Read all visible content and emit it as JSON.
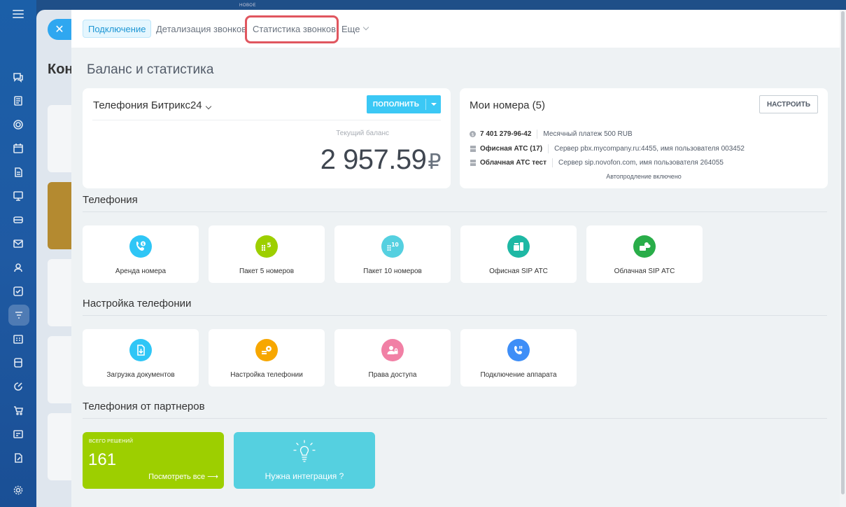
{
  "tabs": {
    "items": [
      {
        "label": "Подключение"
      },
      {
        "label": "Детализация звонков"
      },
      {
        "label": "Статистика звонков"
      },
      {
        "label": "Еще"
      }
    ]
  },
  "background": {
    "title": "Кон",
    "badge": "НОВОЕ"
  },
  "page_title": "Баланс и статистика",
  "telephony_card": {
    "title": "Телефония Битрикс24",
    "topup_label": "ПОПОЛНИТЬ",
    "balance_label": "Текущий баланс",
    "balance_value": "2 957.59",
    "currency": "₽"
  },
  "numbers_card": {
    "title": "Мои номера (5)",
    "setup_label": "НАСТРОИТЬ",
    "rows": [
      {
        "name": "7 401 279-96-42",
        "detail": "Месячный платеж 500 RUB"
      },
      {
        "name": "Офисная АТС (17)",
        "detail": "Сервер pbx.mycompany.ru:4455, имя пользователя 003452"
      },
      {
        "name": "Облачная АТС тест",
        "detail": "Сервер sip.novofon.com, имя пользователя 264055"
      }
    ],
    "auto_renew": "Автопродление включено"
  },
  "sections": {
    "telephony": "Телефония",
    "settings": "Настройка телефонии",
    "partners": "Телефония от партнеров"
  },
  "telephony_tiles": [
    {
      "label": "Аренда номера",
      "color": "#2fc6f6",
      "icon": "phone-rent-icon"
    },
    {
      "label": "Пакет 5 номеров",
      "color": "#9dcf00",
      "icon": "package-5-icon"
    },
    {
      "label": "Пакет 10 номеров",
      "color": "#55d0e0",
      "icon": "package-10-icon"
    },
    {
      "label": "Офисная SIP АТС",
      "color": "#1eb8a4",
      "icon": "office-pbx-icon"
    },
    {
      "label": "Облачная SIP АТС",
      "color": "#29ad49",
      "icon": "cloud-pbx-icon"
    }
  ],
  "settings_tiles": [
    {
      "label": "Загрузка документов",
      "color": "#2fc6f6",
      "icon": "document-upload-icon"
    },
    {
      "label": "Настройка телефонии",
      "color": "#f7a700",
      "icon": "telephony-settings-icon"
    },
    {
      "label": "Права доступа",
      "color": "#f180a5",
      "icon": "access-rights-icon"
    },
    {
      "label": "Подключение аппарата",
      "color": "#3e8ef7",
      "icon": "device-connect-icon"
    }
  ],
  "partners": {
    "total_caption": "ВСЕГО РЕШЕНИЙ",
    "total_count": "161",
    "see_all": "Посмотреть все",
    "need_integration": "Нужна интеграция ?"
  }
}
